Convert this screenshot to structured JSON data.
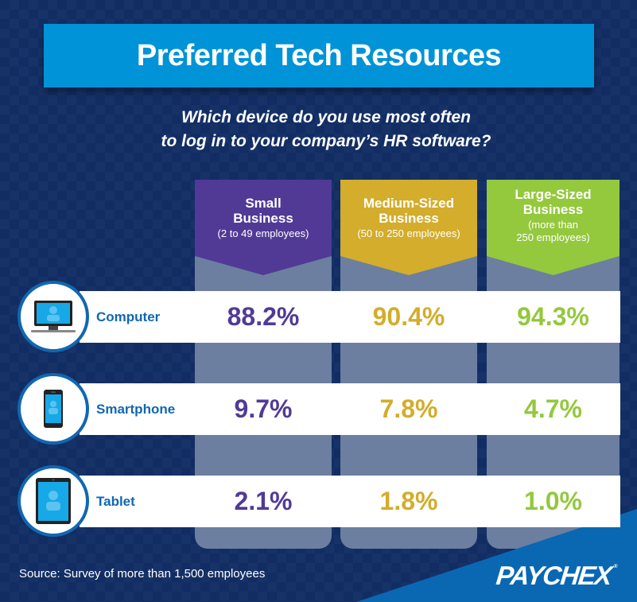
{
  "title": "Preferred Tech Resources",
  "subtitle_lines": [
    "Which device do you use most often",
    "to log in to your company’s HR software?"
  ],
  "colors": {
    "background": "#112d63",
    "banner": "#0093d7",
    "small": "#513a96",
    "medium": "#d3ad2b",
    "large": "#94c83d",
    "row_label": "#1167b1",
    "column_body": "#6c7fa0",
    "corner": "#0a68b3"
  },
  "columns": [
    {
      "key": "small",
      "name_lines": [
        "Small",
        "Business"
      ],
      "sub_lines": [
        "(2 to 49 employees)"
      ]
    },
    {
      "key": "medium",
      "name_lines": [
        "Medium-Sized",
        "Business"
      ],
      "sub_lines": [
        "(50 to 250 employees)"
      ]
    },
    {
      "key": "large",
      "name_lines": [
        "Large-Sized",
        "Business"
      ],
      "sub_lines": [
        "(more than",
        "250 employees)"
      ]
    }
  ],
  "rows": [
    {
      "label": "Computer",
      "icon": "computer-icon",
      "values": [
        "88.2%",
        "90.4%",
        "94.3%"
      ]
    },
    {
      "label": "Smartphone",
      "icon": "smartphone-icon",
      "values": [
        "9.7%",
        "7.8%",
        "4.7%"
      ]
    },
    {
      "label": "Tablet",
      "icon": "tablet-icon",
      "values": [
        "2.1%",
        "1.8%",
        "1.0%"
      ]
    }
  ],
  "source": "Source: Survey of more than 1,500 employees",
  "logo": {
    "text": "PAYCHEX",
    "mark": "®"
  },
  "chart_data": {
    "type": "table",
    "title": "Preferred Tech Resources",
    "subtitle": "Which device do you use most often to log in to your company’s HR software?",
    "columns": [
      "Small Business (2 to 49 employees)",
      "Medium-Sized Business (50 to 250 employees)",
      "Large-Sized Business (more than 250 employees)"
    ],
    "categories": [
      "Computer",
      "Smartphone",
      "Tablet"
    ],
    "series": [
      {
        "name": "Small Business (2 to 49 employees)",
        "values": [
          88.2,
          9.7,
          2.1
        ]
      },
      {
        "name": "Medium-Sized Business (50 to 250 employees)",
        "values": [
          90.4,
          7.8,
          1.8
        ]
      },
      {
        "name": "Large-Sized Business (more than 250 employees)",
        "values": [
          94.3,
          4.7,
          1.0
        ]
      }
    ],
    "unit": "%",
    "source": "Survey of more than 1,500 employees"
  }
}
